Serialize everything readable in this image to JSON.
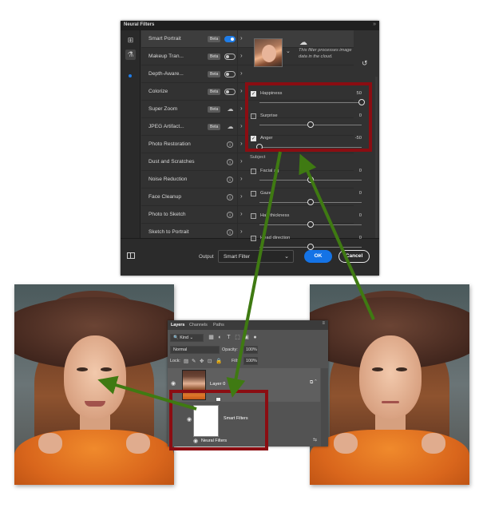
{
  "neural_filters": {
    "title": "Neural Filters",
    "collapse_glyph": "»",
    "filters": [
      {
        "name": "Smart Portrait",
        "badge": "Beta",
        "control": "toggle",
        "on": true,
        "active": true
      },
      {
        "name": "Makeup Tran...",
        "badge": "Beta",
        "control": "toggle",
        "on": false
      },
      {
        "name": "Depth-Aware...",
        "badge": "Beta",
        "control": "toggle",
        "on": false
      },
      {
        "name": "Colorize",
        "badge": "Beta",
        "control": "toggle",
        "on": false
      },
      {
        "name": "Super Zoom",
        "badge": "Beta",
        "control": "cloud"
      },
      {
        "name": "JPEG Artifact...",
        "badge": "Beta",
        "control": "cloud"
      },
      {
        "name": "Photo Restoration",
        "badge": "",
        "control": "info"
      },
      {
        "name": "Dust and Scratches",
        "badge": "",
        "control": "info"
      },
      {
        "name": "Noise Reduction",
        "badge": "",
        "control": "info"
      },
      {
        "name": "Face Cleanup",
        "badge": "",
        "control": "info"
      },
      {
        "name": "Photo to Sketch",
        "badge": "",
        "control": "info"
      },
      {
        "name": "Sketch to Portrait",
        "badge": "",
        "control": "info"
      }
    ],
    "cloud_note": "This filter processes image data in the cloud.",
    "sliders": [
      {
        "label": "Happiness",
        "value": 50,
        "checked": true
      },
      {
        "label": "Surprise",
        "value": 0,
        "checked": false
      },
      {
        "label": "Anger",
        "value": -50,
        "checked": true
      }
    ],
    "subject_section": "Subject",
    "subject_sliders": [
      {
        "label": "Facial ag",
        "value": 0
      },
      {
        "label": "Gaze",
        "value": 0
      },
      {
        "label": "Hair thickness",
        "value": 0
      },
      {
        "label": "Head direction",
        "value": 0
      }
    ],
    "slider_range": [
      -50,
      50
    ],
    "output_label": "Output",
    "output_value": "Smart Filter",
    "ok_label": "OK",
    "cancel_label": "Cancel",
    "accent_color": "#1473e6"
  },
  "layers_panel": {
    "tabs": [
      "Layers",
      "Channels",
      "Paths"
    ],
    "filter_kind": "Kind",
    "blend_mode": "Normal",
    "opacity_label": "Opacity:",
    "opacity_value": "100%",
    "lock_label": "Lock:",
    "fill_label": "Fill:",
    "fill_value": "100%",
    "layer_name": "Layer 0",
    "smart_filters_label": "Smart Filters",
    "neural_filters_label": "Neural Filters"
  },
  "annotation": {
    "highlight_color": "#8b0d12",
    "arrow_color": "#3f7a12"
  }
}
